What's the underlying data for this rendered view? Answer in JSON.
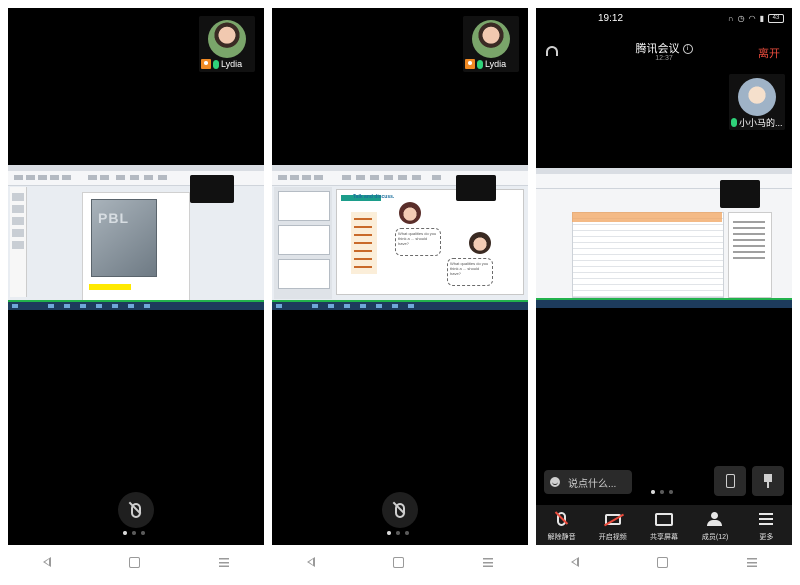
{
  "panel1": {
    "participant_name": "Lydia",
    "page_indicator": "1 of 3"
  },
  "panel2": {
    "participant_name": "Lydia",
    "slide_title": "Talk and discuss.",
    "bubble1": "What qualities do you think a ... should have?",
    "bubble2": "What qualities do you think a ... should have?"
  },
  "panel3": {
    "status_time": "19:12",
    "battery": "43",
    "meeting_title": "腾讯会议",
    "elapsed": "12:37",
    "leave_label": "离开",
    "participant_name": "小小马的...",
    "comment_placeholder": "说点什么...",
    "toolbar": {
      "unmute": "解除静音",
      "video": "开启视频",
      "share": "共享屏幕",
      "members": "成员(12)",
      "more": "更多"
    }
  },
  "colors": {
    "leave": "#e94b3c",
    "mic_active": "#2fd27a",
    "badge_orange": "#f08a24"
  }
}
